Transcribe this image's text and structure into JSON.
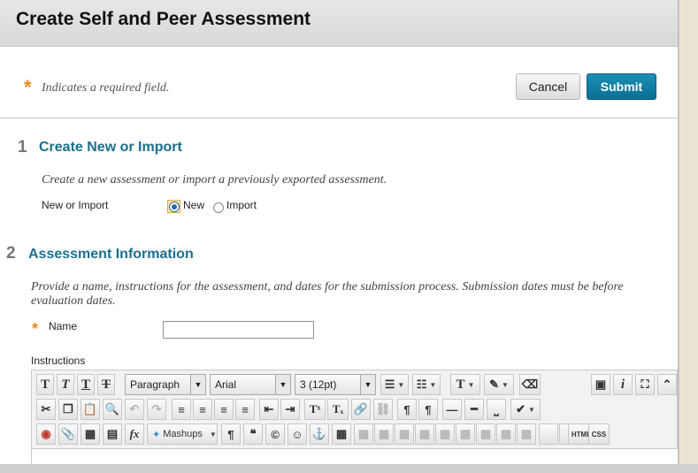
{
  "page": {
    "title": "Create Self and Peer Assessment"
  },
  "required_note": {
    "star": "*",
    "text": "Indicates a required field."
  },
  "buttons": {
    "cancel": "Cancel",
    "submit": "Submit"
  },
  "section1": {
    "number": "1",
    "title": "Create New or Import",
    "instructions": "Create a new assessment or import a previously exported assessment.",
    "field_label": "New or Import",
    "options": [
      "New",
      "Import"
    ],
    "selected": "New"
  },
  "section2": {
    "number": "2",
    "title": "Assessment Information",
    "instructions": "Provide a name, instructions for the assessment, and dates for the submission process. Submission dates must be before evaluation dates.",
    "name_label": "Name",
    "name_value": "",
    "instructions_label": "Instructions"
  },
  "editor": {
    "format_select": "Paragraph",
    "font_select": "Arial",
    "size_select": "3 (12pt)",
    "mashups_label": "Mashups",
    "html_label": "HTML",
    "css_label": "CSS",
    "glyphs": {
      "bold": "T",
      "italic": "T",
      "underline": "T",
      "strike": "T",
      "list_ul": "☰",
      "list_ol": "☷",
      "text_color": "T",
      "highlight": "✎",
      "eraser": "⌫",
      "preview": "▣",
      "info": "i",
      "fullscreen": "⛶",
      "collapse": "⌃",
      "cut": "✂",
      "copy": "❐",
      "paste": "📋",
      "find": "🔍",
      "undo": "↶",
      "redo": "↷",
      "align_left": "≡",
      "align_center": "≡",
      "align_right": "≡",
      "justify": "≡",
      "outdent": "⇤",
      "indent": "⇥",
      "superscript": "Tˣ",
      "subscript": "Tₓ",
      "link": "🔗",
      "unlink": "⛓",
      "ltr": "¶",
      "rtl": "¶",
      "hr": "—",
      "hr2": "━",
      "nbsp": "⎵",
      "spell": "✔",
      "record": "◉",
      "attach": "📎",
      "image": "▦",
      "media": "▤",
      "formula": "fx",
      "paragraph": "¶",
      "quote": "❝",
      "copyright": "©",
      "emoji": "☺",
      "anchor": "⚓",
      "table": "▦"
    }
  }
}
